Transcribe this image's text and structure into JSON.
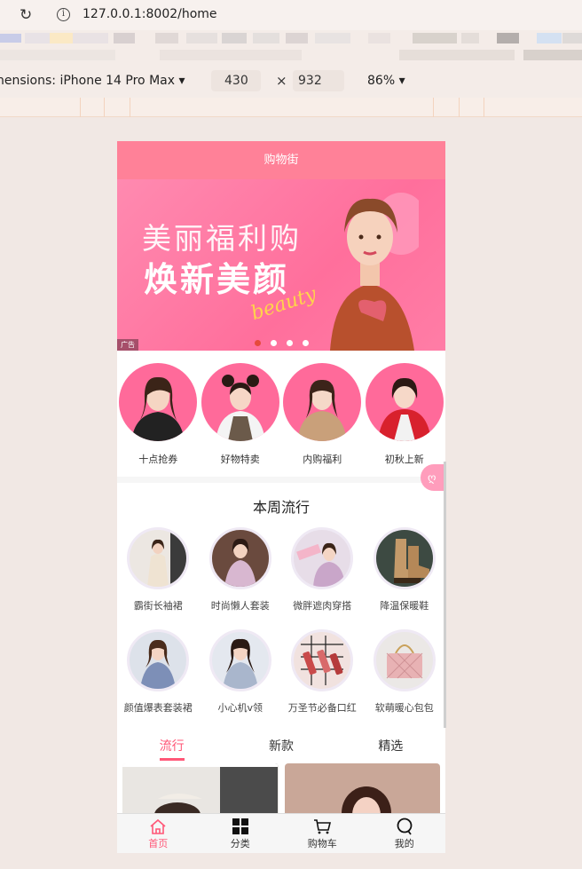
{
  "browser": {
    "url": "127.0.0.1:8002/home",
    "device_label": "nensions: iPhone 14 Pro Max",
    "width": "430",
    "height": "932",
    "times": "×",
    "zoom": "86%"
  },
  "app": {
    "nav_title": "购物街",
    "banner": {
      "line1": "美丽福利购",
      "line2": "焕新美颜",
      "script": "beauty",
      "ad_tag": "广告"
    },
    "recommend": [
      {
        "label": "十点抢券"
      },
      {
        "label": "好物特卖"
      },
      {
        "label": "内购福利"
      },
      {
        "label": "初秋上新"
      }
    ],
    "float_btn": "ღ",
    "week_title": "本周流行",
    "popular": [
      {
        "label": "霸街长袖裙"
      },
      {
        "label": "时尚懒人套装"
      },
      {
        "label": "微胖遮肉穿搭"
      },
      {
        "label": "降温保暖鞋"
      },
      {
        "label": "颜值爆表套装裙"
      },
      {
        "label": "小心机v领"
      },
      {
        "label": "万圣节必备口红"
      },
      {
        "label": "软萌暖心包包"
      }
    ],
    "tabs": [
      "流行",
      "新款",
      "精选"
    ],
    "tabbar": [
      {
        "label": "首页",
        "icon": "home-icon"
      },
      {
        "label": "分类",
        "icon": "category-icon"
      },
      {
        "label": "购物车",
        "icon": "cart-icon"
      },
      {
        "label": "我的",
        "icon": "profile-icon"
      }
    ],
    "colors": {
      "primary": "#ff5777",
      "nav": "#ff8198"
    }
  }
}
